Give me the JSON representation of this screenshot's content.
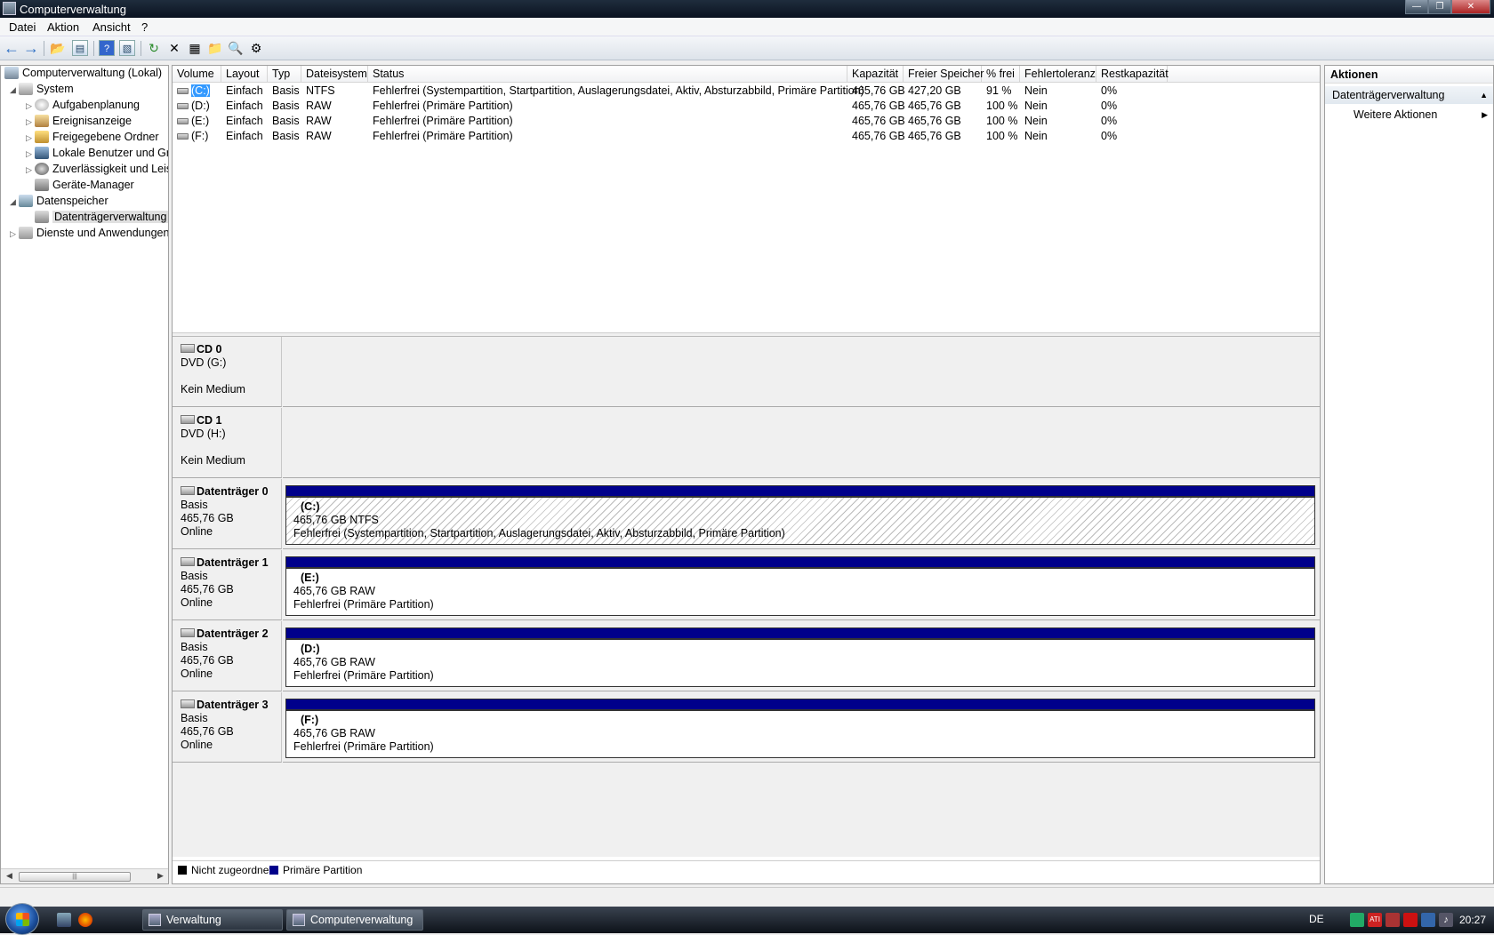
{
  "window": {
    "title": "Computerverwaltung"
  },
  "menu": [
    "Datei",
    "Aktion",
    "Ansicht",
    "?"
  ],
  "tree": {
    "root": "Computerverwaltung (Lokal)",
    "items": [
      {
        "label": "System"
      },
      {
        "label": "Aufgabenplanung"
      },
      {
        "label": "Ereignisanzeige"
      },
      {
        "label": "Freigegebene Ordner"
      },
      {
        "label": "Lokale Benutzer und Gr"
      },
      {
        "label": "Zuverlässigkeit und Leis"
      },
      {
        "label": "Geräte-Manager"
      },
      {
        "label": "Datenspeicher"
      },
      {
        "label": "Datenträgerverwaltung"
      },
      {
        "label": "Dienste und Anwendungen"
      }
    ]
  },
  "volumes": {
    "columns": [
      "Volume",
      "Layout",
      "Typ",
      "Dateisystem",
      "Status",
      "Kapazität",
      "Freier Speicher",
      "% frei",
      "Fehlertoleranz",
      "Restkapazität"
    ],
    "rows": [
      {
        "volume": "(C:)",
        "layout": "Einfach",
        "typ": "Basis",
        "fs": "NTFS",
        "status": "Fehlerfrei (Systempartition, Startpartition, Auslagerungsdatei, Aktiv, Absturzabbild, Primäre Partition)",
        "cap": "465,76 GB",
        "free": "427,20 GB",
        "pct": "91 %",
        "ft": "Nein",
        "rest": "0%"
      },
      {
        "volume": "(D:)",
        "layout": "Einfach",
        "typ": "Basis",
        "fs": "RAW",
        "status": "Fehlerfrei (Primäre Partition)",
        "cap": "465,76 GB",
        "free": "465,76 GB",
        "pct": "100 %",
        "ft": "Nein",
        "rest": "0%"
      },
      {
        "volume": "(E:)",
        "layout": "Einfach",
        "typ": "Basis",
        "fs": "RAW",
        "status": "Fehlerfrei (Primäre Partition)",
        "cap": "465,76 GB",
        "free": "465,76 GB",
        "pct": "100 %",
        "ft": "Nein",
        "rest": "0%"
      },
      {
        "volume": "(F:)",
        "layout": "Einfach",
        "typ": "Basis",
        "fs": "RAW",
        "status": "Fehlerfrei (Primäre Partition)",
        "cap": "465,76 GB",
        "free": "465,76 GB",
        "pct": "100 %",
        "ft": "Nein",
        "rest": "0%"
      }
    ]
  },
  "disks": [
    {
      "name": "CD 0",
      "line1": "DVD (G:)",
      "line2": "",
      "line3": "Kein Medium"
    },
    {
      "name": "CD 1",
      "line1": "DVD (H:)",
      "line2": "",
      "line3": "Kein Medium"
    },
    {
      "name": "Datenträger 0",
      "line1": "Basis",
      "line2": "465,76 GB",
      "line3": "Online",
      "part": {
        "label": "(C:)",
        "size": "465,76 GB NTFS",
        "status": "Fehlerfrei (Systempartition, Startpartition, Auslagerungsdatei, Aktiv, Absturzabbild, Primäre Partition)"
      }
    },
    {
      "name": "Datenträger 1",
      "line1": "Basis",
      "line2": "465,76 GB",
      "line3": "Online",
      "part": {
        "label": "(E:)",
        "size": "465,76 GB RAW",
        "status": "Fehlerfrei (Primäre Partition)"
      }
    },
    {
      "name": "Datenträger 2",
      "line1": "Basis",
      "line2": "465,76 GB",
      "line3": "Online",
      "part": {
        "label": "(D:)",
        "size": "465,76 GB RAW",
        "status": "Fehlerfrei (Primäre Partition)"
      }
    },
    {
      "name": "Datenträger 3",
      "line1": "Basis",
      "line2": "465,76 GB",
      "line3": "Online",
      "part": {
        "label": "(F:)",
        "size": "465,76 GB RAW",
        "status": "Fehlerfrei (Primäre Partition)"
      }
    }
  ],
  "legend": {
    "unallocated": "Nicht zugeordnet",
    "primary": "Primäre Partition",
    "unallocated_color": "#000000",
    "primary_color": "#00008b"
  },
  "actions": {
    "title": "Aktionen",
    "section": "Datenträgerverwaltung",
    "more": "Weitere Aktionen"
  },
  "taskbar": {
    "task1": "Verwaltung",
    "task2": "Computerverwaltung",
    "lang": "DE",
    "clock": "20:27"
  }
}
